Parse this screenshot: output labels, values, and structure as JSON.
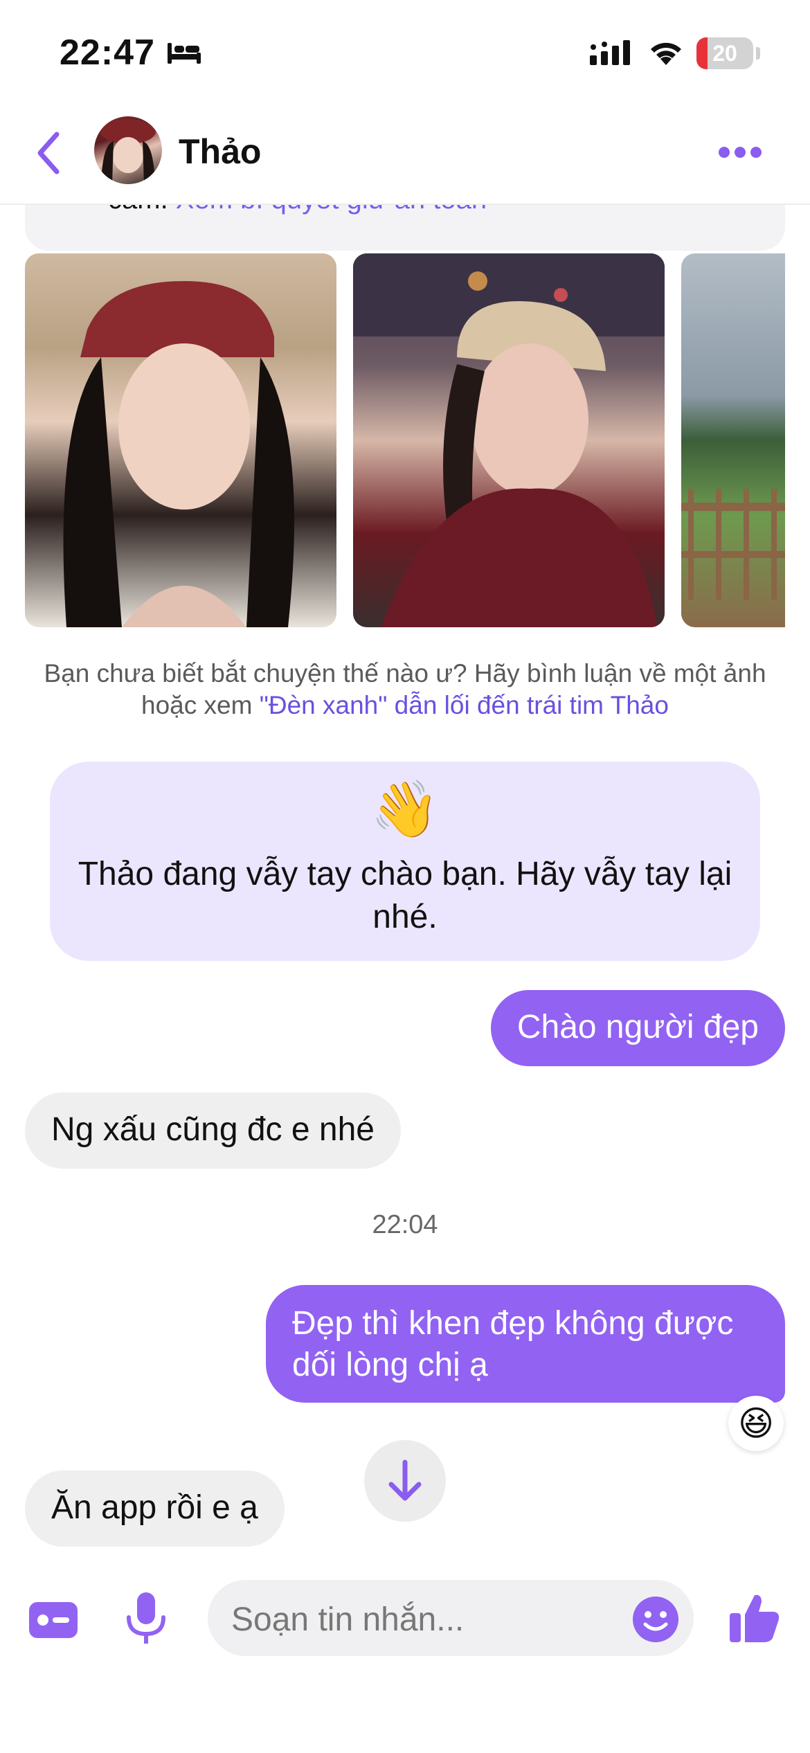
{
  "status_bar": {
    "time": "22:47",
    "battery_level": "20",
    "battery_fraction": 0.2
  },
  "header": {
    "name": "Thảo"
  },
  "tip": {
    "text_prefix": "cảm. ",
    "link": "Xem bí quyết giữ an toàn"
  },
  "hint": {
    "text": "Bạn chưa biết bắt chuyện thế nào ư? Hãy bình luận về một ảnh hoặc xem ",
    "link": "\"Đèn xanh\" dẫn lối đến trái tim Thảo"
  },
  "wave": {
    "emoji": "👋",
    "text": "Thảo đang vẫy tay chào bạn. Hãy vẫy tay lại nhé."
  },
  "messages": [
    {
      "side": "out",
      "text": "Chào người đẹp"
    },
    {
      "side": "in",
      "text": "Ng xấu cũng đc e nhé"
    },
    {
      "side": "out",
      "text": "Đẹp thì khen đẹp không được dối lòng chị ạ",
      "reaction": "😆"
    },
    {
      "side": "in",
      "text": "Ăn app rồi e ạ"
    }
  ],
  "timestamp": "22:04",
  "composer": {
    "placeholder": "Soạn tin nhắn..."
  },
  "colors": {
    "accent": "#9262f3",
    "wave_bg": "#ebe6fe",
    "incoming_bg": "#efefef",
    "link": "#6a4fe0"
  }
}
